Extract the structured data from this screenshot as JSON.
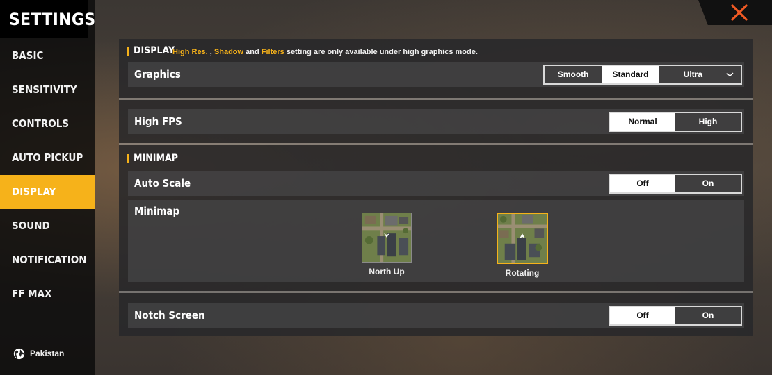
{
  "sidebar": {
    "title": "SETTINGS",
    "items": [
      {
        "label": "BASIC"
      },
      {
        "label": "SENSITIVITY"
      },
      {
        "label": "CONTROLS"
      },
      {
        "label": "AUTO PICKUP"
      },
      {
        "label": "DISPLAY"
      },
      {
        "label": "SOUND"
      },
      {
        "label": "NOTIFICATION"
      },
      {
        "label": "FF MAX"
      }
    ],
    "active": "DISPLAY",
    "region": "Pakistan"
  },
  "display_section": {
    "title": "DISPLAY",
    "note_hl1": "High Res.",
    "note_sep1": " , ",
    "note_hl2": "Shadow",
    "note_sep2": " and ",
    "note_hl3": "Filters",
    "note_rest": " setting are only available under high graphics mode."
  },
  "graphics": {
    "label": "Graphics",
    "options": [
      "Smooth",
      "Standard",
      "Ultra"
    ],
    "selected": "Standard"
  },
  "high_fps": {
    "label": "High FPS",
    "options": [
      "Normal",
      "High"
    ],
    "selected": "Normal"
  },
  "minimap_section": {
    "title": "MINIMAP"
  },
  "auto_scale": {
    "label": "Auto Scale",
    "options": [
      "Off",
      "On"
    ],
    "selected": "Off"
  },
  "minimap": {
    "label": "Minimap",
    "options": [
      "North Up",
      "Rotating"
    ],
    "selected": "Rotating"
  },
  "notch_screen": {
    "label": "Notch Screen",
    "options": [
      "Off",
      "On"
    ],
    "selected": "Off"
  },
  "colors": {
    "accent": "#f6b21a",
    "close": "#f15a24"
  },
  "icons": {
    "close": "close-icon",
    "globe": "globe-icon",
    "dropdown": "chevron-down-icon"
  }
}
